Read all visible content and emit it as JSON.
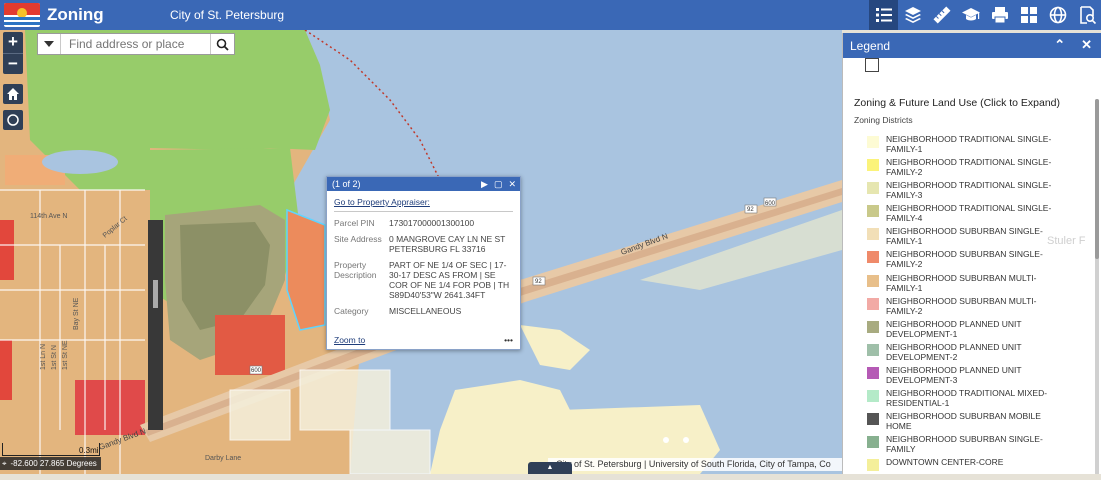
{
  "header": {
    "app_title": "Zoning",
    "org_title": "City of St. Petersburg",
    "tools": [
      {
        "icon": "legend-list-icon",
        "active": true
      },
      {
        "icon": "layers-icon"
      },
      {
        "icon": "measure-ruler-icon"
      },
      {
        "icon": "graduation-cap-icon"
      },
      {
        "icon": "print-icon"
      },
      {
        "icon": "basemap-gallery-icon"
      },
      {
        "icon": "globe-icon"
      },
      {
        "icon": "query-search-icon"
      }
    ]
  },
  "search": {
    "placeholder": "Find address or place"
  },
  "popup": {
    "counter": "(1 of 2)",
    "link": "Go to Property Appraiser:",
    "fields": [
      {
        "label": "Parcel PIN",
        "value": "173017000001300100"
      },
      {
        "label": "Site Address",
        "value": "0 MANGROVE CAY LN NE ST PETERSBURG FL 33716"
      },
      {
        "label": "Property Description",
        "value": "PART OF NE 1/4 OF SEC | 17-30-17 DESC AS FROM | SE COR OF NE 1/4 FOR POB | TH S89D40'53\"W 2641.34FT"
      },
      {
        "label": "Category",
        "value": "MISCELLANEOUS"
      }
    ],
    "zoom_link": "Zoom to",
    "more": "•••"
  },
  "map": {
    "scale_label": "0.3mi",
    "coordinates": "-82.600 27.865 Degrees",
    "attribution": "City of St. Petersburg | University of South Florida, City of Tampa, Co",
    "road_labels": [
      "Gandy Blvd N",
      "Gandy Blvd N",
      "92",
      "92",
      "600",
      "600",
      "Darby Lane",
      "114th Ave N",
      "1st St NE",
      "1st St N",
      "1st Ln N",
      "Bay St NE",
      "Poplar Ct"
    ],
    "ghost_text": "Stuler F"
  },
  "legend": {
    "title": "Legend",
    "layer_title": "Zoning & Future Land Use (Click to Expand)",
    "subtitle": "Zoning Districts",
    "items": [
      {
        "label": "NEIGHBORHOOD TRADITIONAL SINGLE-FAMILY-1",
        "color": "#fdfbd4"
      },
      {
        "label": "NEIGHBORHOOD TRADITIONAL SINGLE-FAMILY-2",
        "color": "#fbf37a"
      },
      {
        "label": "NEIGHBORHOOD TRADITIONAL SINGLE-FAMILY-3",
        "color": "#e6e6b0"
      },
      {
        "label": "NEIGHBORHOOD TRADITIONAL SINGLE-FAMILY-4",
        "color": "#c9c98a"
      },
      {
        "label": "NEIGHBORHOOD SUBURBAN SINGLE-FAMILY-1",
        "color": "#f2dfb7"
      },
      {
        "label": "NEIGHBORHOOD SUBURBAN SINGLE-FAMILY-2",
        "color": "#ef8a6a"
      },
      {
        "label": "NEIGHBORHOOD SUBURBAN MULTI-FAMILY-1",
        "color": "#e8bf8a"
      },
      {
        "label": "NEIGHBORHOOD SUBURBAN MULTI-FAMILY-2",
        "color": "#f2aaa5"
      },
      {
        "label": "NEIGHBORHOOD PLANNED UNIT DEVELOPMENT-1",
        "color": "#a8ab80"
      },
      {
        "label": "NEIGHBORHOOD PLANNED UNIT DEVELOPMENT-2",
        "color": "#9fbfa9"
      },
      {
        "label": "NEIGHBORHOOD PLANNED UNIT DEVELOPMENT-3",
        "color": "#b55ab5"
      },
      {
        "label": "NEIGHBORHOOD TRADITIONAL MIXED-RESIDENTIAL-1",
        "color": "#b4eac8"
      },
      {
        "label": "NEIGHBORHOOD SUBURBAN MOBILE HOME",
        "color": "#555555"
      },
      {
        "label": "NEIGHBORHOOD SUBURBAN SINGLE-FAMILY",
        "color": "#87b08f"
      },
      {
        "label": "DOWNTOWN CENTER-CORE",
        "color": "#f4ef9a"
      }
    ]
  }
}
